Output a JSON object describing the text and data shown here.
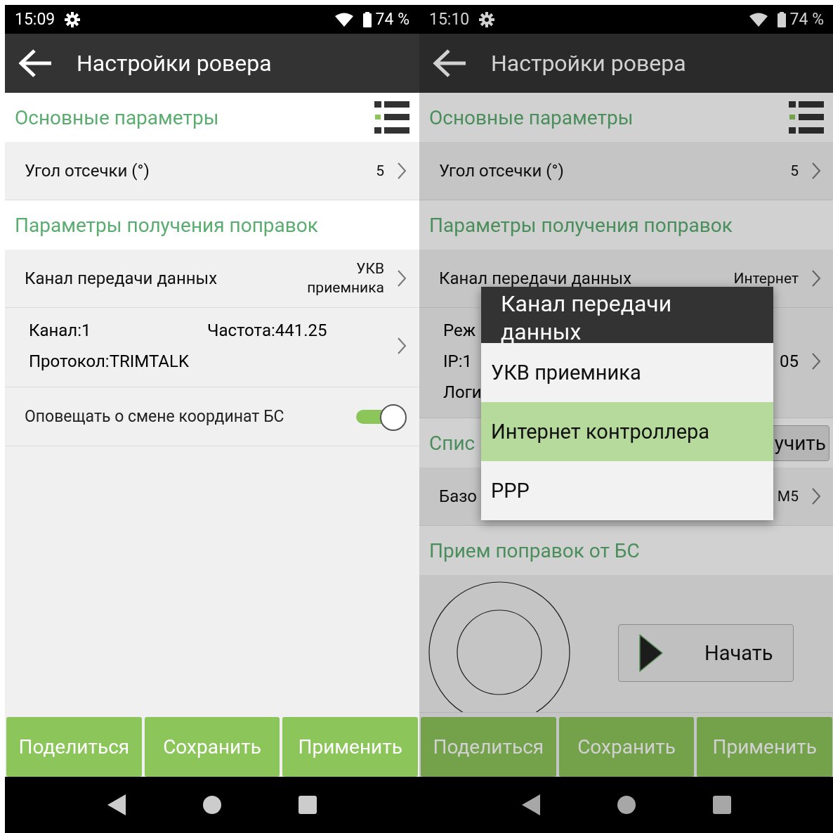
{
  "screens": [
    {
      "status_bar": {
        "time": "15:09",
        "battery": "74 %"
      },
      "title": "Настройки ровера",
      "dimmed": false,
      "sections": [
        {
          "title": "Основные параметры",
          "rows": [
            {
              "kind": "value",
              "label": "Угол отсечки (°)",
              "value": [
                "5"
              ]
            }
          ]
        },
        {
          "title": "Параметры получения поправок",
          "rows": [
            {
              "kind": "value",
              "label": "Канал передачи данных",
              "value": [
                "УКВ",
                "приемника"
              ]
            },
            {
              "kind": "detail",
              "lines": [
                {
                  "text": "Канал:1",
                  "column_2": "Частота:441.25"
                },
                {
                  "text": "Протокол:TRIMTALK"
                }
              ]
            },
            {
              "kind": "toggle",
              "label": "Оповещать о смене координат БС",
              "on": true
            }
          ]
        }
      ],
      "buttons": [
        "Поделиться",
        "Сохранить",
        "Применить"
      ]
    },
    {
      "status_bar": {
        "time": "15:10",
        "battery": "74 %"
      },
      "title": "Настройки ровера",
      "dimmed": true,
      "sections": [
        {
          "title": "Основные параметры",
          "rows": [
            {
              "kind": "value",
              "label": "Угол отсечки (°)",
              "value": [
                "5"
              ]
            }
          ]
        },
        {
          "title": "Параметры получения поправок",
          "rows": [
            {
              "kind": "value",
              "label": "Канал передачи данных",
              "value": [
                "Интернет"
              ]
            },
            {
              "kind": "detail",
              "lines": [
                {
                  "text": "Реж"
                },
                {
                  "text": "IP:1",
                  "end": "05"
                },
                {
                  "text": "Логи"
                }
              ]
            }
          ]
        },
        {
          "title": "Спис",
          "action": "учить",
          "rows": [
            {
              "kind": "value",
              "label": "Базо",
              "value": [
                "M5"
              ]
            }
          ]
        },
        {
          "title": "Прием поправок от БС",
          "rows": [
            {
              "kind": "start",
              "button": "Начать"
            }
          ]
        }
      ],
      "buttons": [
        "Поделиться",
        "Сохранить",
        "Применить"
      ],
      "dialog": {
        "title": "Канал передачи данных",
        "options": [
          {
            "label": "УКВ приемника",
            "selected": false
          },
          {
            "label": "Интернет контроллера",
            "selected": true
          },
          {
            "label": "PPP",
            "selected": false
          }
        ]
      }
    }
  ]
}
